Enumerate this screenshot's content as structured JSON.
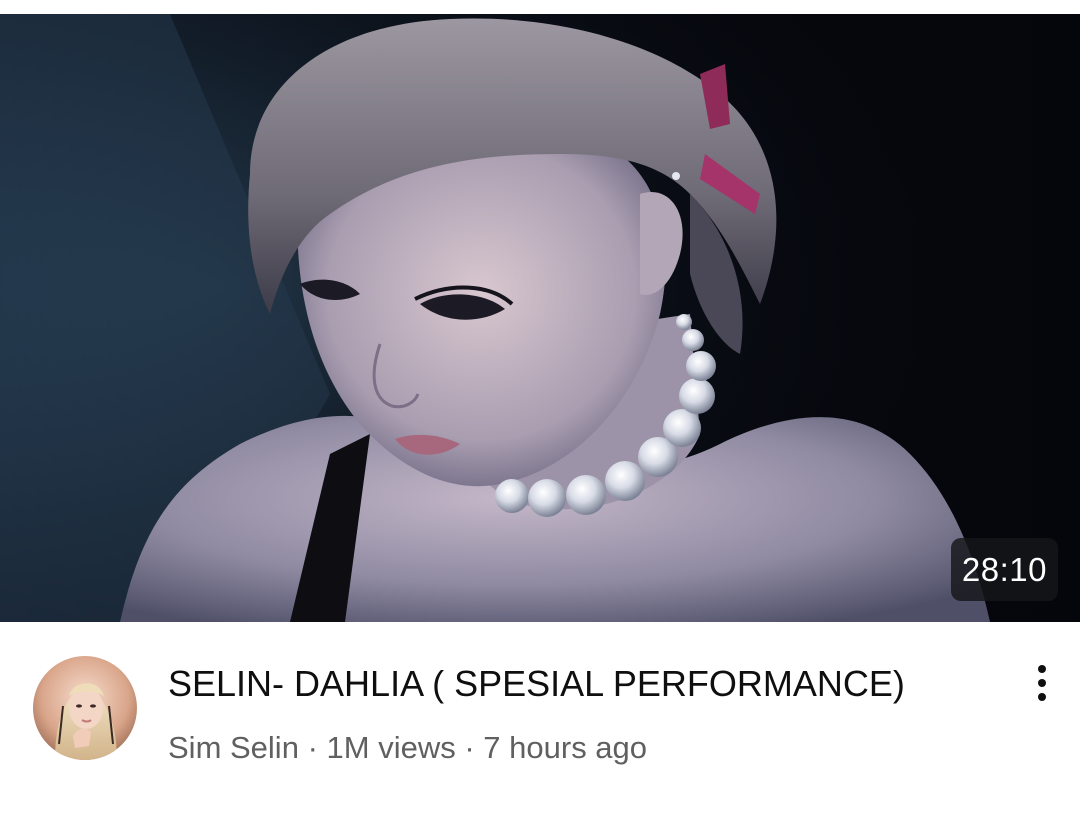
{
  "video": {
    "title": "SELIN- DAHLIA ( SPESIAL PERFORMANCE)",
    "duration": "28:10",
    "channel": "Sim Selin",
    "separator": "·",
    "views": "1M views",
    "age": "7 hours ago"
  },
  "icons": {
    "thumbnail": "performer-still-image",
    "avatar": "channel-avatar-portrait",
    "menu": "more-vert-icon"
  },
  "colors": {
    "title_text": "#0f0f0f",
    "secondary_text": "#606060",
    "duration_badge_bg": "#16161a"
  }
}
